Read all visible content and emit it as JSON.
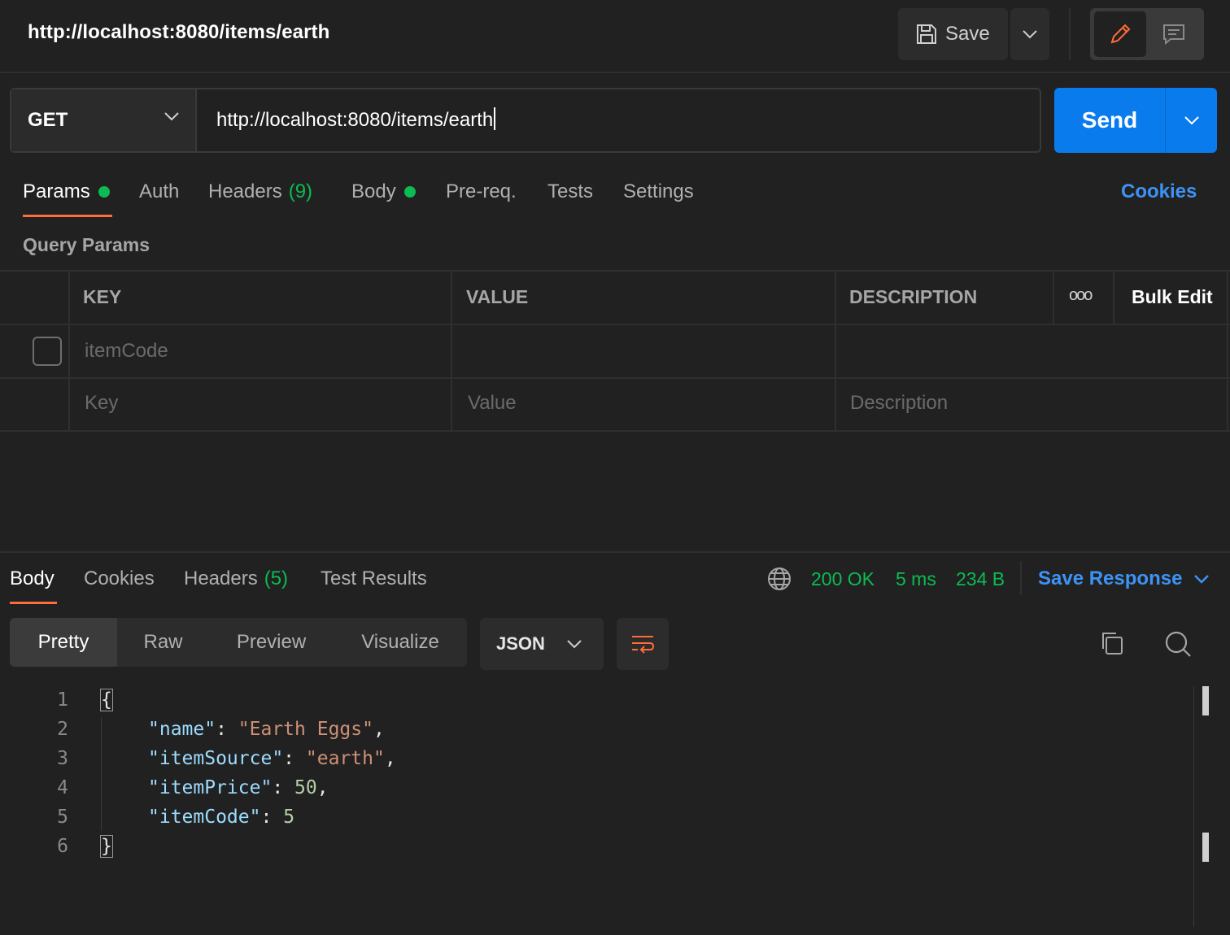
{
  "header": {
    "title": "http://localhost:8080/items/earth",
    "save_label": "Save"
  },
  "request": {
    "method": "GET",
    "url": "http://localhost:8080/items/earth",
    "send_label": "Send"
  },
  "request_tabs": [
    {
      "label": "Params",
      "has_dot": true
    },
    {
      "label": "Auth"
    },
    {
      "label": "Headers",
      "count": "(9)"
    },
    {
      "label": "Body",
      "has_dot": true
    },
    {
      "label": "Pre-req."
    },
    {
      "label": "Tests"
    },
    {
      "label": "Settings"
    }
  ],
  "cookies_link": "Cookies",
  "query_params": {
    "title": "Query Params",
    "columns": [
      "KEY",
      "VALUE",
      "DESCRIPTION"
    ],
    "more_label": "ooo",
    "bulk_edit_label": "Bulk Edit",
    "rows": [
      {
        "key": "itemCode",
        "value": "",
        "description": ""
      }
    ],
    "placeholders": {
      "key": "Key",
      "value": "Value",
      "description": "Description"
    }
  },
  "response": {
    "tabs": [
      {
        "label": "Body"
      },
      {
        "label": "Cookies"
      },
      {
        "label": "Headers",
        "count": "(5)"
      },
      {
        "label": "Test Results"
      }
    ],
    "status": "200 OK",
    "time": "5 ms",
    "size": "234 B",
    "save_response_label": "Save Response",
    "view_modes": [
      "Pretty",
      "Raw",
      "Preview",
      "Visualize"
    ],
    "format": "JSON",
    "code_lines": [
      {
        "num": "1",
        "text": "{"
      },
      {
        "num": "2",
        "key": "\"name\"",
        "value": "\"Earth Eggs\"",
        "vtype": "string",
        "trail": ","
      },
      {
        "num": "3",
        "key": "\"itemSource\"",
        "value": "\"earth\"",
        "vtype": "string",
        "trail": ","
      },
      {
        "num": "4",
        "key": "\"itemPrice\"",
        "value": "50",
        "vtype": "number",
        "trail": ","
      },
      {
        "num": "5",
        "key": "\"itemCode\"",
        "value": "5",
        "vtype": "number",
        "trail": ""
      },
      {
        "num": "6",
        "text": "}"
      }
    ]
  },
  "colors": {
    "background": "#212121",
    "accent": "#ff6c37",
    "primary": "#097bed",
    "success": "#0cbb52",
    "link": "#3d93f5"
  },
  "icons": [
    "save-icon",
    "chevron-down-icon",
    "pencil-icon",
    "comment-icon",
    "globe-icon",
    "wrap-lines-icon",
    "copy-icon",
    "search-icon"
  ]
}
